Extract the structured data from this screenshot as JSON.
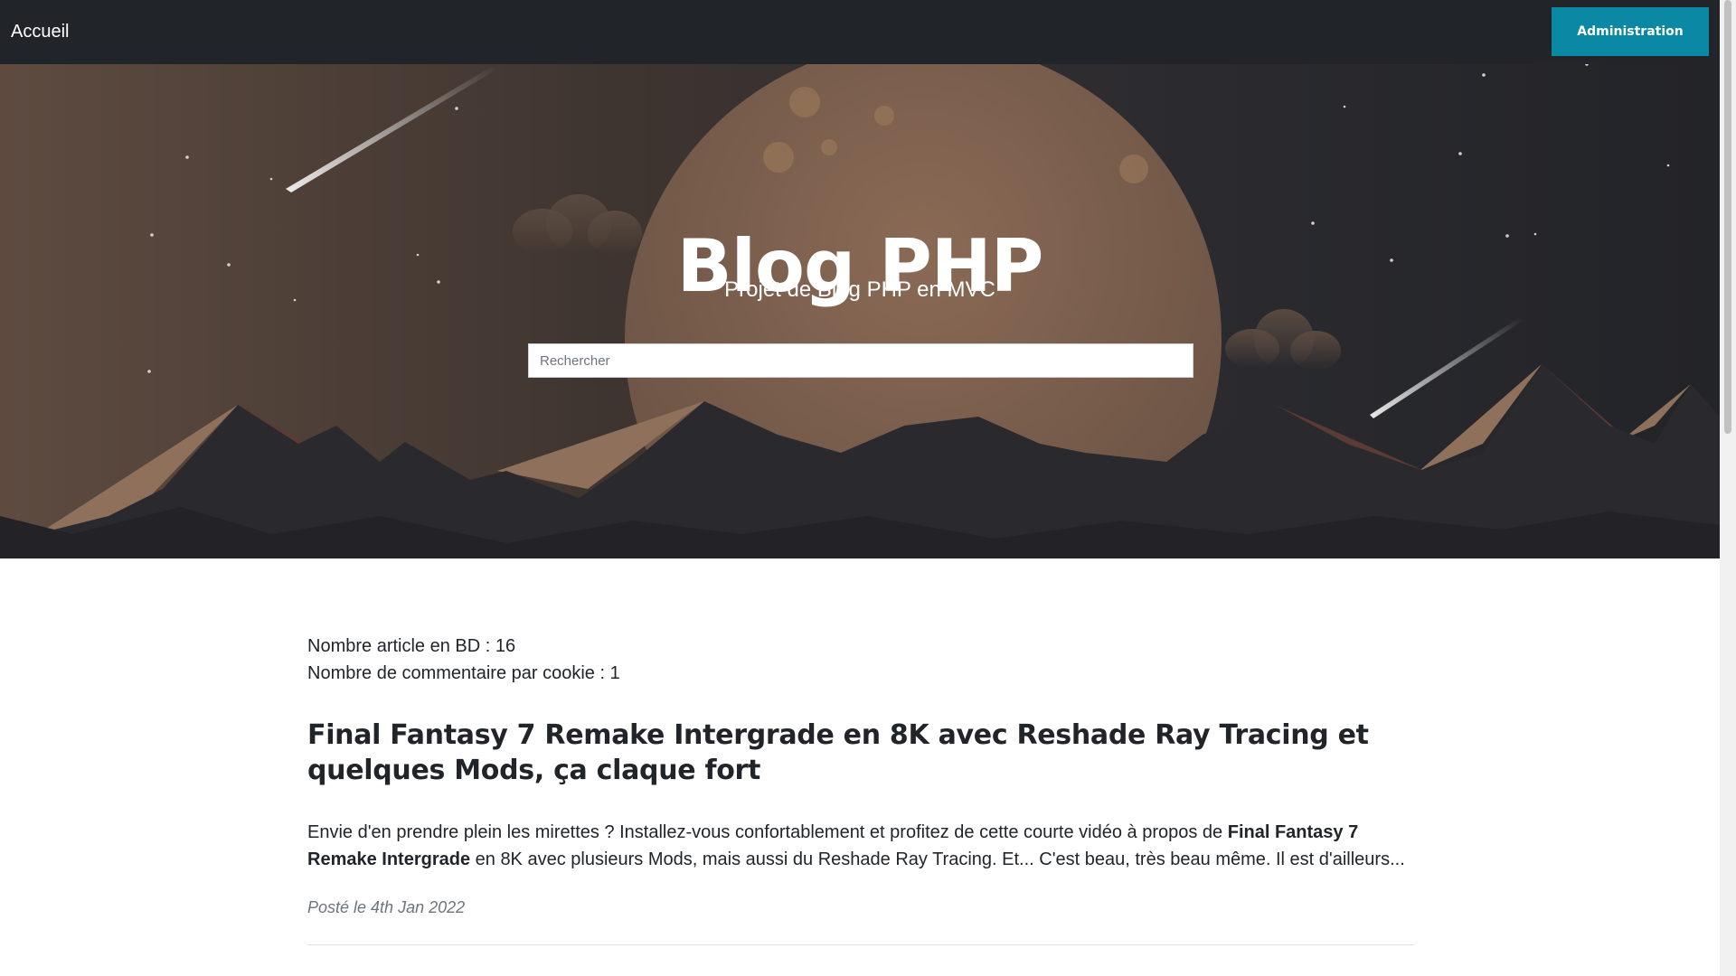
{
  "navbar": {
    "home_label": "Accueil",
    "admin_label": "Administration",
    "admin_color": "#0b88a3"
  },
  "hero": {
    "title": "Blog PHP",
    "subtitle": "Projet de Blog PHP en MVC",
    "search_placeholder": "Rechercher",
    "background_scene": "night-mountains-moon"
  },
  "stats": {
    "article_count_text": "Nombre article en BD : 16",
    "comment_cookie_text": "Nombre de commentaire par cookie : 1"
  },
  "posts": [
    {
      "title": "Final Fantasy 7 Remake Intergrade en 8K avec Reshade Ray Tracing et quelques Mods, ça claque fort",
      "excerpt_before": "Envie d'en prendre plein les mirettes ? Installez-vous confortablement et profitez de cette courte vidéo à propos de ",
      "excerpt_bold": "Final Fantasy 7 Remake Intergrade",
      "excerpt_after": " en 8K avec plusieurs Mods, mais aussi du Reshade Ray Tracing. Et... C'est beau, très beau même. Il est d'ailleurs...",
      "meta": "Posté le 4th Jan 2022"
    }
  ]
}
